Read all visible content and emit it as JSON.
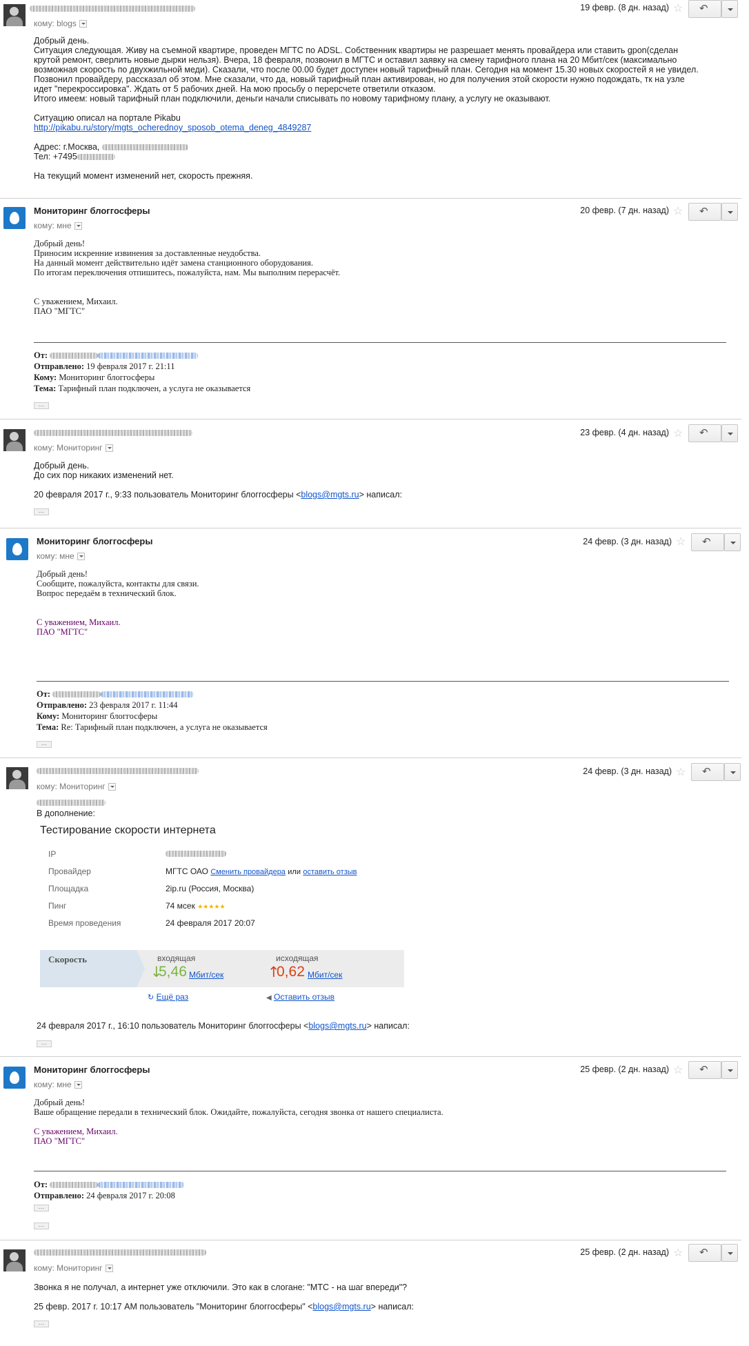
{
  "messages": [
    {
      "to_label": "кому: blogs",
      "date": "19 февр. (8 дн. назад)",
      "body": [
        "Добрый день.",
        "Ситуация следующая. Живу на съемной квартире, проведен МГТС по ADSL. Собственник квартиры не разрешает менять провайдера или ставить gpon(сделан",
        "крутой ремонт, сверлить новые дырки нельзя). Вчера, 18 февраля, позвонил в МГТС и оставил заявку на смену тарифного плана на 20 Мбит/сек (максимально",
        "возможная скорость по двухжильной меди). Сказали, что после 00.00 будет доступен новый тарифный план. Сегодня на момент 15.30 новых скоростей я не увидел.",
        "Позвонил провайдеру, рассказал об этом. Мне сказали, что да, новый тарифный план активирован, но для получения этой скорости нужно подождать, тк на узле",
        "идет \"перекроссировка\". Ждать от 5 рабочих дней. На мою просьбу о перерсчете ответили отказом.",
        "Итого имеем: новый тарифный план подключили, деньги начали списывать по новому тарифному плану, а услугу не оказывают."
      ],
      "pikabu_intro": "Ситуацию описал на портале Pikabu",
      "pikabu_link": "http://pikabu.ru/story/mgts_ocherednoy_sposob_otema_deneg_4849287",
      "address": "Адрес: г.Москва, ",
      "phone": "Тел: +7495",
      "footer": "На текущий момент изменений нет, скорость прежняя."
    },
    {
      "sender": "Мониторинг блоггосферы",
      "to_label": "кому: мне",
      "date": "20 февр. (7 дн. назад)",
      "body": [
        "Добрый день!",
        "Приносим искренние извинения за доставленные неудобства.",
        "На данный момент действительно идёт замена станционного оборудования.",
        "По итогам переключения отпишитесь, пожалуйста, нам. Мы выполним перерасчёт."
      ],
      "sign": [
        "С уважением, Михаил.",
        "ПАО \"МГТС\""
      ],
      "quote": {
        "from_label": "От:",
        "sent_label": "Отправлено:",
        "sent_value": "19 февраля 2017 г. 21:11",
        "to_label": "Кому:",
        "to_value": "Мониторинг блоггосферы",
        "subject_label": "Тема:",
        "subject_value": "Тарифный план подключен, а услуга не оказывается"
      }
    },
    {
      "to_label": "кому: Мониторинг",
      "date": "23 февр. (4 дн. назад)",
      "body": [
        "Добрый день.",
        "До сих пор никаких изменений нет."
      ],
      "reply_prefix": "20 февраля 2017 г., 9:33 пользователь Мониторинг блоггосферы <",
      "reply_email": "blogs@mgts.ru",
      "reply_suffix": "> написал:"
    },
    {
      "sender": "Мониторинг блоггосферы",
      "to_label": "кому: мне",
      "date": "24 февр. (3 дн. назад)",
      "body": [
        "Добрый день!",
        "Сообщите, пожалуйста, контакты для связи.",
        "Вопрос передаём в технический блок."
      ],
      "sign": [
        "С уважением, Михаил.",
        "ПАО \"МГТС\""
      ],
      "quote": {
        "from_label": "От:",
        "sent_label": "Отправлено:",
        "sent_value": "23 февраля 2017 г. 11:44",
        "to_label": "Кому:",
        "to_value": "Мониторинг блоггосферы",
        "subject_label": "Тема:",
        "subject_value": "Re: Тарифный план подключен, а услуга не оказывается"
      }
    },
    {
      "to_label": "кому: Мониторинг",
      "date": "24 февр. (3 дн. назад)",
      "addition": "В дополнение:",
      "speedtest": {
        "title": "Тестирование скорости интернета",
        "rows": [
          {
            "label": "IP",
            "value": ""
          },
          {
            "label": "Провайдер",
            "value": "МГТС ОАО",
            "link1": "Сменить провайдера",
            "mid": "или",
            "link2": "оставить отзыв"
          },
          {
            "label": "Площадка",
            "value": "2ip.ru (Россия, Москва)"
          },
          {
            "label": "Пинг",
            "value": "74 мсек",
            "stars": "★★★★★"
          },
          {
            "label": "Время проведения",
            "value": "24 февраля 2017 20:07"
          }
        ],
        "speed_label": "Скорость",
        "in_label": "входящая",
        "in_arrow": "↓",
        "in_value": "5,46",
        "in_unit": "Мбит/сек",
        "out_label": "исходящая",
        "out_arrow": "↑",
        "out_value": "0,62",
        "out_unit": "Мбит/сек",
        "again": "Ещё раз",
        "review": "Оставить отзыв",
        "in_color": "#7cb342",
        "out_color": "#d84315"
      },
      "reply_prefix": "24 февраля 2017 г., 16:10 пользователь Мониторинг блоггосферы <",
      "reply_email": "blogs@mgts.ru",
      "reply_suffix": "> написал:"
    },
    {
      "sender": "Мониторинг блоггосферы",
      "to_label": "кому: мне",
      "date": "25 февр. (2 дн. назад)",
      "body": [
        "Добрый день!",
        "Ваше обращение передали в технический блок. Ожидайте, пожалуйста, сегодня звонка от нашего специалиста."
      ],
      "sign": [
        "С уважением, Михаил.",
        "ПАО \"МГТС\""
      ],
      "quote": {
        "from_label": "От:",
        "sent_label": "Отправлено:",
        "sent_value": "24 февраля 2017 г. 20:08"
      }
    },
    {
      "to_label": "кому: Мониторинг",
      "date": "25 февр. (2 дн. назад)",
      "body": [
        "Звонка я не получал, а интернет уже отключили. Это как в слогане: \"МТС - на шаг впереди\"?"
      ],
      "reply_prefix": "25 февр. 2017 г. 10:17 AM пользователь \"Мониторинг блоггосферы\" <",
      "reply_email": "blogs@mgts.ru",
      "reply_suffix": "> написал:"
    }
  ],
  "icons": {
    "star": "star-icon",
    "reply": "reply-icon",
    "more": "chevron-down-icon"
  },
  "colors": {
    "link": "#1155cc",
    "signature": "#660066",
    "avatar_blog": "#1e78c8"
  }
}
